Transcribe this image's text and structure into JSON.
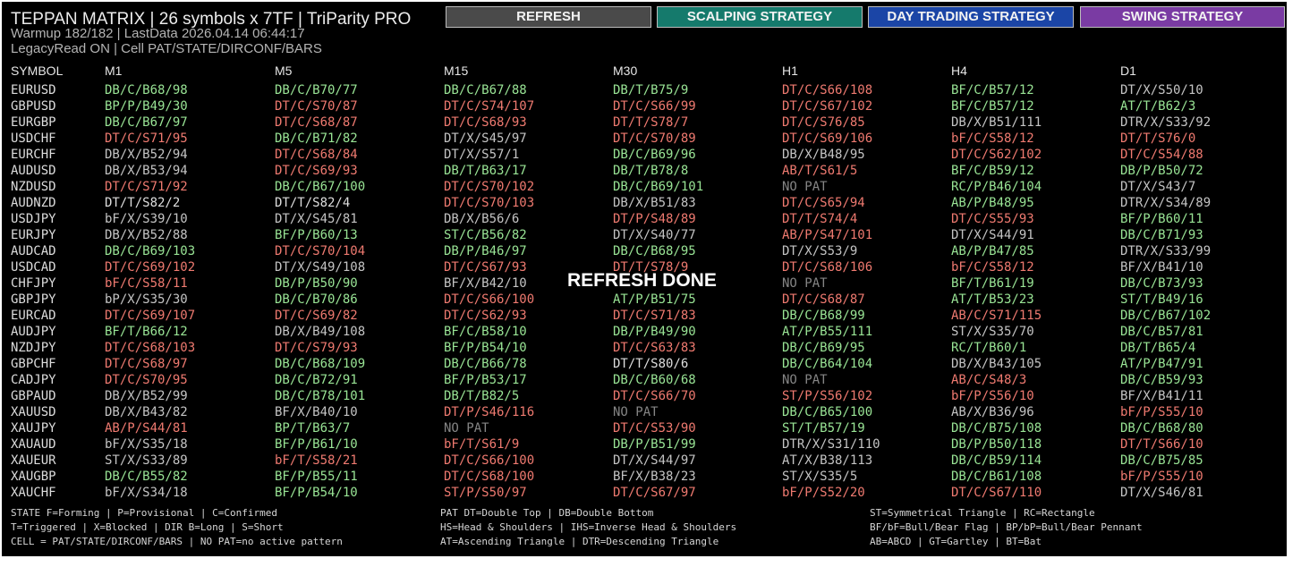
{
  "header": {
    "title": "TEPPAN MATRIX | 26 symbols x 7TF | TriParity PRO",
    "status_line": "Warmup 182/182 | LastData 2026.04.14 06:44:17",
    "info_line": "LegacyRead ON | Cell PAT/STATE/DIRCONF/BARS"
  },
  "buttons": [
    {
      "label": "REFRESH",
      "bg": "#4a4a4a"
    },
    {
      "label": "SCALPING STRATEGY",
      "bg": "#157a6c"
    },
    {
      "label": "DAY TRADING STRATEGY",
      "bg": "#1b45a6"
    },
    {
      "label": "SWING STRATEGY",
      "bg": "#7a3ba3"
    }
  ],
  "colors": {
    "bullish": "#99e495",
    "bearish": "#ef7a70",
    "neutral": "#dedede",
    "no_pattern": "#858585"
  },
  "matrix": {
    "symbol_header": "SYMBOL",
    "timeframes": [
      "M1",
      "M5",
      "M15",
      "M30",
      "H1",
      "H4",
      "D1"
    ],
    "rows": [
      {
        "symbol": "EURUSD",
        "cells": [
          "DB/C/B68/98",
          "DB/C/B70/77",
          "DB/C/B67/88",
          "DB/T/B75/9",
          "DT/C/S66/108",
          "BF/C/B57/12",
          "DT/X/S50/10"
        ]
      },
      {
        "symbol": "GBPUSD",
        "cells": [
          "BP/P/B49/30",
          "DT/C/S70/87",
          "DT/C/S74/107",
          "DT/C/S66/99",
          "DT/C/S67/102",
          "BF/C/B57/12",
          "AT/T/B62/3"
        ]
      },
      {
        "symbol": "EURGBP",
        "cells": [
          "DB/C/B67/97",
          "DT/C/S68/87",
          "DT/C/S68/93",
          "DT/T/S78/7",
          "DT/C/S76/85",
          "DB/X/B51/111",
          "DTR/X/S33/92"
        ]
      },
      {
        "symbol": "USDCHF",
        "cells": [
          "DT/C/S71/95",
          "DB/C/B71/82",
          "DT/X/S45/97",
          "DT/C/S70/89",
          "DT/C/S69/106",
          "bF/C/S58/12",
          "DT/T/S76/0"
        ]
      },
      {
        "symbol": "EURCHF",
        "cells": [
          "DB/X/B52/94",
          "DT/C/S68/84",
          "DT/X/S57/1",
          "DB/C/B69/96",
          "DB/X/B48/95",
          "DT/C/S62/102",
          "DT/C/S54/88"
        ]
      },
      {
        "symbol": "AUDUSD",
        "cells": [
          "DB/X/B53/94",
          "DT/C/S69/93",
          "DB/T/B63/17",
          "DB/T/B78/8",
          "AB/T/S61/5",
          "BF/C/B59/12",
          "DB/P/B50/72"
        ]
      },
      {
        "symbol": "NZDUSD",
        "cells": [
          "DT/C/S71/92",
          "DB/C/B67/100",
          "DT/C/S70/102",
          "DB/C/B69/101",
          "NO PAT",
          "RC/P/B46/104",
          "DT/X/S43/7"
        ]
      },
      {
        "symbol": "AUDNZD",
        "cells": [
          "DT/T/S82/2",
          "DT/T/S82/4",
          "DT/C/S70/103",
          "DB/X/B51/83",
          "DT/C/S65/94",
          "AB/P/B48/95",
          "DTR/X/S34/89"
        ]
      },
      {
        "symbol": "USDJPY",
        "cells": [
          "bF/X/S39/10",
          "DT/X/S45/81",
          "DB/X/B56/6",
          "DT/P/S48/89",
          "DT/T/S74/4",
          "DT/C/S55/93",
          "BF/P/B60/11"
        ]
      },
      {
        "symbol": "EURJPY",
        "cells": [
          "DB/X/B52/88",
          "BF/P/B60/13",
          "ST/C/B56/82",
          "DT/X/S40/77",
          "AB/P/S47/101",
          "DT/X/S44/91",
          "DB/C/B71/93"
        ]
      },
      {
        "symbol": "AUDCAD",
        "cells": [
          "DB/C/B69/103",
          "DT/C/S70/104",
          "DB/P/B46/97",
          "DB/C/B68/95",
          "DT/X/S53/9",
          "AB/P/B47/85",
          "DTR/X/S33/99"
        ]
      },
      {
        "symbol": "USDCAD",
        "cells": [
          "DT/C/S69/102",
          "DT/X/S49/108",
          "DT/C/S67/93",
          "DT/T/S78/9",
          "DT/C/S68/106",
          "bF/C/S58/12",
          "BF/X/B41/10"
        ]
      },
      {
        "symbol": "CHFJPY",
        "cells": [
          "bF/C/S58/11",
          "DB/P/B50/90",
          "BF/X/B42/10",
          "",
          "NO PAT",
          "BF/T/B61/19",
          "DB/C/B73/93"
        ]
      },
      {
        "symbol": "GBPJPY",
        "cells": [
          "bP/X/S35/30",
          "DB/C/B70/86",
          "DT/C/S66/100",
          "AT/P/B51/75",
          "DT/C/S68/87",
          "AT/T/B53/23",
          "ST/T/B49/16"
        ]
      },
      {
        "symbol": "EURCAD",
        "cells": [
          "DT/C/S69/107",
          "DT/C/S69/82",
          "DT/C/S62/93",
          "DT/C/S71/83",
          "DB/C/B68/99",
          "AB/C/S71/115",
          "DB/C/B67/102"
        ]
      },
      {
        "symbol": "AUDJPY",
        "cells": [
          "BF/T/B66/12",
          "DB/X/B49/108",
          "BF/C/B58/10",
          "DB/P/B49/90",
          "AT/P/B55/111",
          "ST/X/S35/70",
          "DB/C/B57/81"
        ]
      },
      {
        "symbol": "NZDJPY",
        "cells": [
          "DT/C/S68/103",
          "DT/C/S79/93",
          "BF/P/B54/10",
          "DT/C/S63/83",
          "DB/C/B69/95",
          "RC/T/B60/1",
          "DB/T/B65/4"
        ]
      },
      {
        "symbol": "GBPCHF",
        "cells": [
          "DT/C/S68/97",
          "DB/C/B68/109",
          "DB/C/B66/78",
          "DT/T/S80/6",
          "DB/C/B64/104",
          "DB/X/B43/105",
          "AT/P/B47/91"
        ]
      },
      {
        "symbol": "CADJPY",
        "cells": [
          "DT/C/S70/95",
          "DB/C/B72/91",
          "BF/P/B53/17",
          "DB/C/B60/68",
          "NO PAT",
          "AB/C/S48/3",
          "DB/C/B59/93"
        ]
      },
      {
        "symbol": "GBPAUD",
        "cells": [
          "DB/X/B52/99",
          "DB/C/B78/101",
          "DB/T/B82/5",
          "DT/C/S66/70",
          "ST/P/S56/102",
          "bF/P/S56/10",
          "BF/X/B41/11"
        ]
      },
      {
        "symbol": "XAUUSD",
        "cells": [
          "DB/X/B43/82",
          "BF/X/B40/10",
          "DT/P/S46/116",
          "NO PAT",
          "DB/C/B65/100",
          "AB/X/B36/96",
          "bF/P/S55/10"
        ]
      },
      {
        "symbol": "XAUJPY",
        "cells": [
          "AB/P/S44/81",
          "BP/T/B63/7",
          "NO PAT",
          "DT/C/S53/90",
          "ST/T/B57/19",
          "DB/C/B75/108",
          "DB/C/B68/80"
        ]
      },
      {
        "symbol": "XAUAUD",
        "cells": [
          "bF/X/S35/18",
          "BF/P/B61/10",
          "bF/T/S61/9",
          "DB/P/B51/99",
          "DTR/X/S31/110",
          "DB/P/B50/118",
          "DT/T/S66/10"
        ]
      },
      {
        "symbol": "XAUEUR",
        "cells": [
          "ST/X/S33/89",
          "bF/T/S58/21",
          "DT/C/S66/100",
          "DT/X/S44/97",
          "AT/X/B38/113",
          "DB/C/B59/114",
          "DB/C/B75/85"
        ]
      },
      {
        "symbol": "XAUGBP",
        "cells": [
          "DB/C/B55/82",
          "BF/P/B55/11",
          "DT/C/S68/100",
          "BF/X/B38/23",
          "ST/X/S35/5",
          "DB/C/B61/108",
          "bF/P/S55/10"
        ]
      },
      {
        "symbol": "XAUCHF",
        "cells": [
          "bF/X/S34/18",
          "BF/P/B54/10",
          "ST/P/S50/97",
          "DT/C/S67/97",
          "bF/P/S52/20",
          "DT/C/S67/110",
          "DT/X/S46/81"
        ]
      }
    ]
  },
  "legend": [
    "STATE F=Forming | P=Provisional | C=Confirmed",
    "T=Triggered | X=Blocked | DIR B=Long | S=Short",
    "CELL = PAT/STATE/DIRCONF/BARS | NO PAT=no active pattern",
    "PAT DT=Double Top | DB=Double Bottom",
    "HS=Head & Shoulders | IHS=Inverse Head & Shoulders",
    "AT=Ascending Triangle | DTR=Descending Triangle",
    "ST=Symmetrical Triangle | RC=Rectangle",
    "BF/bF=Bull/Bear Flag | BP/bP=Bull/Bear Pennant",
    "AB=ABCD | GT=Gartley | BT=Bat"
  ],
  "toast": "REFRESH DONE"
}
